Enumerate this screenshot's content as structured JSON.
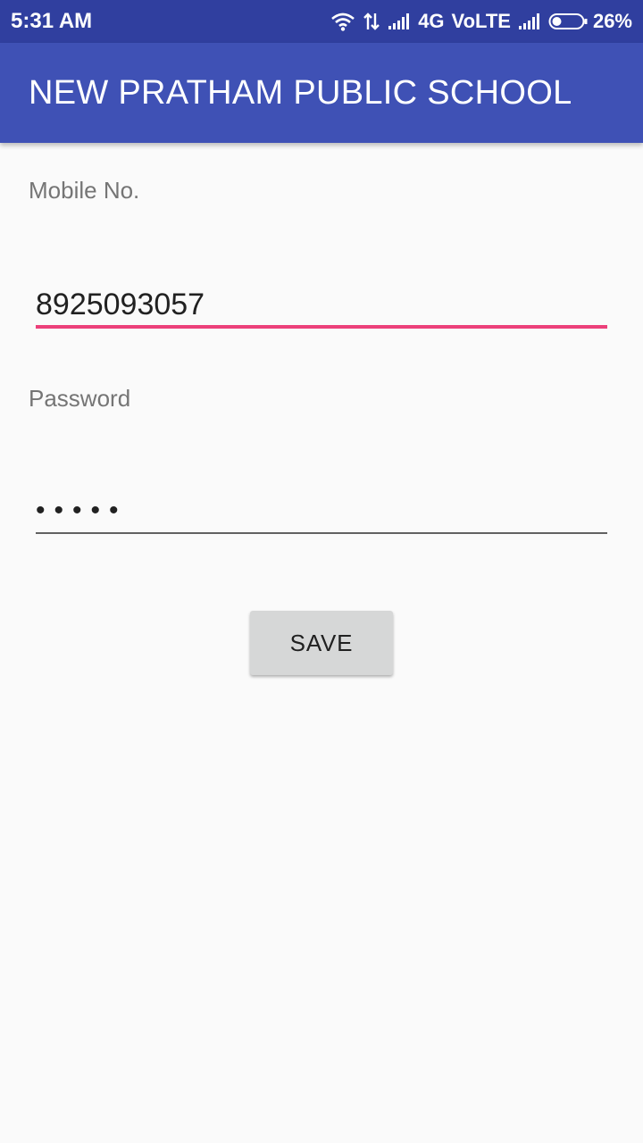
{
  "status_bar": {
    "time": "5:31 AM",
    "network": "4G",
    "volte": "VoLTE",
    "battery": "26%",
    "icons": [
      "wifi-icon",
      "data-transfer-icon",
      "signal-icon",
      "signal-icon",
      "battery-icon"
    ]
  },
  "app_bar": {
    "title": "NEW PRATHAM PUBLIC SCHOOL",
    "color": "#3f51b5"
  },
  "form": {
    "mobile_label": "Mobile No.",
    "mobile_value": "8925093057",
    "password_label": "Password",
    "password_value": "•••••",
    "save_label": "SAVE",
    "accent_color": "#ec407a"
  }
}
